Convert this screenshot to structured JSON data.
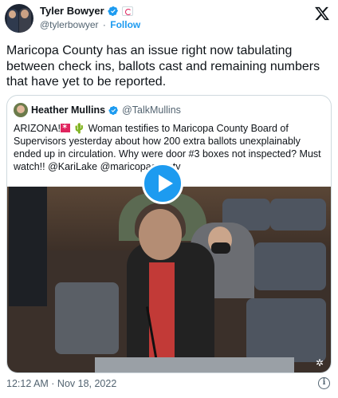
{
  "author": {
    "display_name": "Tyler Bowyer",
    "handle": "@tylerbowyer",
    "separator": "·",
    "follow_label": "Follow"
  },
  "tweet": {
    "text": "Maricopa County has an issue right now tabulating between check ins, ballots cast and remaining numbers that have yet to be reported.",
    "timestamp": "12:12 AM · Nov 18, 2022"
  },
  "quoted_tweet": {
    "display_name": "Heather Mullins",
    "handle": "@TalkMullins",
    "text_prefix": "ARIZONA!",
    "text_body": " Woman testifies to Maricopa County Board of Supervisors yesterday about how 200 extra ballots unexplainably ended up in circulation. Why were door #3 boxes not inspected? Must watch!! @KariLake @maricopacounty"
  },
  "icons": {
    "verified": "verified-badge-icon",
    "x_logo": "x-logo-icon",
    "play": "play-icon",
    "info": "info-icon"
  },
  "colors": {
    "accent": "#1d9bf0",
    "text": "#0f1419",
    "secondary_text": "#536471",
    "border": "#cfd9de"
  }
}
